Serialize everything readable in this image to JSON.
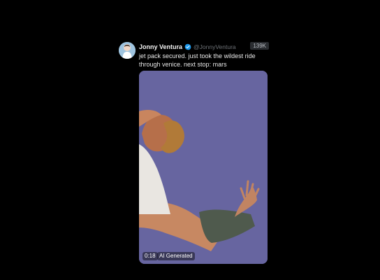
{
  "post": {
    "author": {
      "display_name": "Jonny Ventura",
      "handle": "@JonnyVentura",
      "verified": true
    },
    "views": "139K",
    "text": "jet pack secured. just took the wildest ride through venice. next stop: mars",
    "media": {
      "duration": "0:18",
      "label": "AI Generated",
      "background_color": "#6765a0"
    }
  },
  "colors": {
    "page_background": "#000000",
    "verified_badge": "#1d9bf0"
  },
  "icons": {
    "avatar": "avatar",
    "verified": "verified-badge-icon"
  }
}
